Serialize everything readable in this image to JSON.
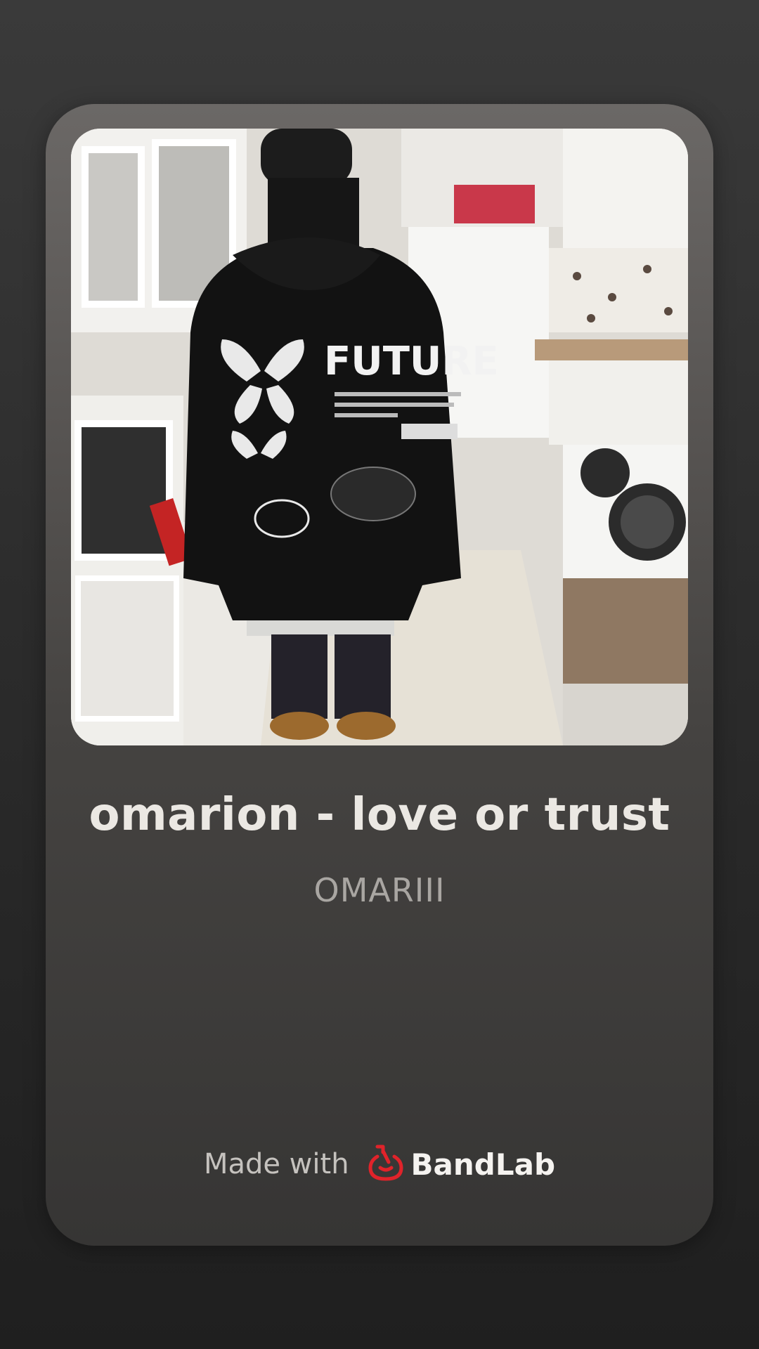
{
  "track": {
    "title": "omarion - love or trust",
    "artist": "OMARIII"
  },
  "footer": {
    "made_with": "Made with",
    "brand": "BandLab",
    "brand_color": "#e0232a"
  },
  "artwork": {
    "icon": "cover-art-image",
    "hoodie_text": "FUTURE"
  }
}
